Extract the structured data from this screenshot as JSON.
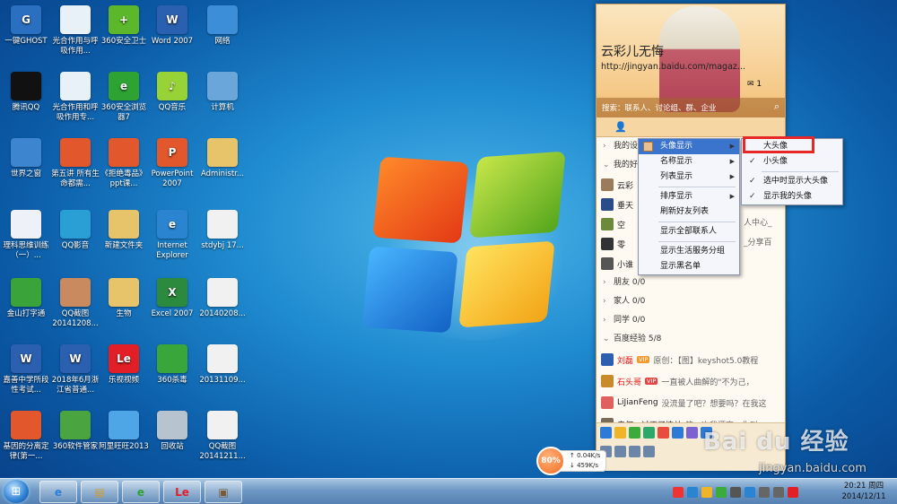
{
  "desktop": {
    "icons": [
      {
        "label": "一键GHOST",
        "color": "#2b6fc0",
        "glyph": "G"
      },
      {
        "label": "光合作用与呼吸作用...",
        "color": "#e8f0f8",
        "glyph": ""
      },
      {
        "label": "360安全卫士",
        "color": "#5cb82a",
        "glyph": "+"
      },
      {
        "label": "Word 2007",
        "color": "#2b5faf",
        "glyph": "W"
      },
      {
        "label": "网络",
        "color": "#3c8ed8",
        "glyph": ""
      },
      {
        "label": "腾讯QQ",
        "color": "#111",
        "glyph": ""
      },
      {
        "label": "光合作用和呼吸作用专...",
        "color": "#e8f0f8",
        "glyph": ""
      },
      {
        "label": "360安全浏览器7",
        "color": "#2fa234",
        "glyph": "e"
      },
      {
        "label": "QQ音乐",
        "color": "#97d237",
        "glyph": "♪"
      },
      {
        "label": "计算机",
        "color": "#6aa6d9",
        "glyph": ""
      },
      {
        "label": "世界之窗",
        "color": "#3d86cf",
        "glyph": ""
      },
      {
        "label": "第五讲 所有生命都需...",
        "color": "#e2572b",
        "glyph": ""
      },
      {
        "label": "《拒绝毒品》ppt课...",
        "color": "#e2572b",
        "glyph": ""
      },
      {
        "label": "PowerPoint 2007",
        "color": "#e2572b",
        "glyph": "P"
      },
      {
        "label": "Administr...",
        "color": "#e7c46a",
        "glyph": ""
      },
      {
        "label": "理科思维训练（一）...",
        "color": "#eef2f8",
        "glyph": ""
      },
      {
        "label": "QQ影音",
        "color": "#2a9fd6",
        "glyph": ""
      },
      {
        "label": "新建文件夹",
        "color": "#e7c46a",
        "glyph": ""
      },
      {
        "label": "Internet Explorer",
        "color": "#2a84d0",
        "glyph": "e"
      },
      {
        "label": "stdybj 17...",
        "color": "#f1f1f1",
        "glyph": ""
      },
      {
        "label": "金山打字通",
        "color": "#3aa33a",
        "glyph": ""
      },
      {
        "label": "QQ截图20141208...",
        "color": "#c88a5e",
        "glyph": ""
      },
      {
        "label": "生物",
        "color": "#e7c46a",
        "glyph": ""
      },
      {
        "label": "Excel 2007",
        "color": "#2c8a3e",
        "glyph": "X"
      },
      {
        "label": "20140208...",
        "color": "#f1f1f1",
        "glyph": ""
      },
      {
        "label": "嘉善中学所段性考试...",
        "color": "#2b5faf",
        "glyph": "W"
      },
      {
        "label": "2018年6月浙江省普通...",
        "color": "#2b5faf",
        "glyph": "W"
      },
      {
        "label": "乐视视频",
        "color": "#e21f26",
        "glyph": "Le"
      },
      {
        "label": "360杀毒",
        "color": "#38a63a",
        "glyph": ""
      },
      {
        "label": "20131109...",
        "color": "#f1f1f1",
        "glyph": ""
      },
      {
        "label": "基因的分离定律(第一...",
        "color": "#e2572b",
        "glyph": ""
      },
      {
        "label": "360软件管家",
        "color": "#4aa43f",
        "glyph": ""
      },
      {
        "label": "阿里旺旺2013",
        "color": "#4fa6e6",
        "glyph": ""
      },
      {
        "label": "回收站",
        "color": "#b7c3cf",
        "glyph": ""
      },
      {
        "label": "QQ截图20141211...",
        "color": "#f1f1f1",
        "glyph": ""
      }
    ]
  },
  "qq_panel": {
    "nickname": "云彩儿无悔",
    "signature": "http://jingyan.baidu.com/magaz...",
    "mail_count": "1",
    "search_placeholder": "搜索：联系人、讨论组、群、企业",
    "groups": [
      {
        "label": "我的设备"
      },
      {
        "label": "我的好友"
      }
    ],
    "contacts_top": [
      {
        "name": "云彩",
        "color": "#9a7b5c"
      },
      {
        "name": "垂天",
        "color": "#2a4c88"
      },
      {
        "name": "空",
        "color": "#6b8a3a"
      },
      {
        "name": "零",
        "color": "#333"
      },
      {
        "name": "小谁",
        "color": "#555"
      }
    ],
    "other_groups": [
      {
        "label": "朋友 0/0"
      },
      {
        "label": "家人 0/0"
      },
      {
        "label": "同学 0/0"
      },
      {
        "label": "百度经验 5/8"
      }
    ],
    "contacts_bottom": [
      {
        "name": "刘磊",
        "msg": "原创：【图】keyshot5.0教程",
        "red": true,
        "tag": "VIP",
        "color": "#2d5fb0"
      },
      {
        "name": "石头哥",
        "msg": "一直被人曲解的\"不为己，",
        "red": true,
        "tag": "VIP",
        "color": "#c98a2a"
      },
      {
        "name": "LiJianFeng",
        "msg": "没流量了吧？想要吗？在我这",
        "red": false,
        "tag": "",
        "color": "#e06060"
      },
      {
        "name": "亲何，过不了情关",
        "msg": "第一次我漂亮，你叫",
        "red": false,
        "tag": "",
        "color": "#7a6a58"
      }
    ],
    "hint_right1": "人中心_",
    "hint_right2": "_分享百"
  },
  "menu_main": [
    {
      "label": "头像显示",
      "submenu": true,
      "hot": true,
      "icon": true
    },
    {
      "label": "名称显示",
      "submenu": true
    },
    {
      "label": "列表显示",
      "submenu": true
    },
    {
      "sep": true
    },
    {
      "label": "排序显示",
      "submenu": true
    },
    {
      "label": "刷新好友列表"
    },
    {
      "sep": true
    },
    {
      "label": "显示全部联系人"
    },
    {
      "sep": true
    },
    {
      "label": "显示生活服务分组"
    },
    {
      "label": "显示黑名单"
    }
  ],
  "menu_sub": [
    {
      "label": "大头像",
      "checked": false
    },
    {
      "label": "小头像",
      "checked": true
    },
    {
      "sep": true
    },
    {
      "label": "选中时显示大头像",
      "checked": true
    },
    {
      "label": "显示我的头像",
      "checked": true
    }
  ],
  "speed_widget": {
    "percent": "80%",
    "up": "0.04K/s",
    "down": "459K/s"
  },
  "taskbar": {
    "clock_time": "20:21 周四",
    "clock_date": "2014/12/11"
  },
  "watermark": {
    "brand": "Bai du 经验",
    "url": "jingyan.baidu.com"
  }
}
